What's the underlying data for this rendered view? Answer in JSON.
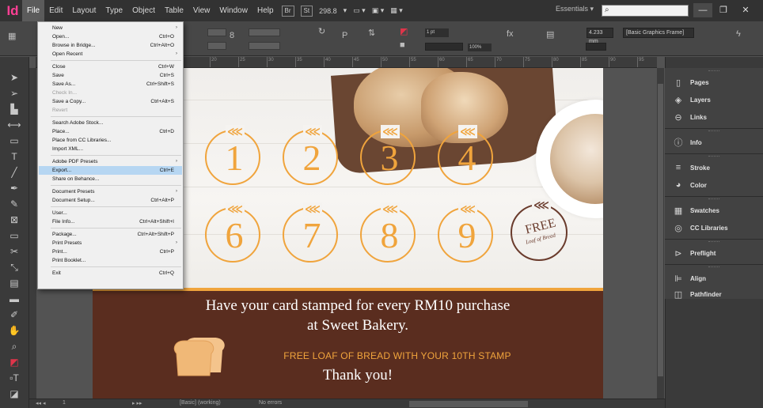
{
  "app": {
    "logo": "Id"
  },
  "menubar": {
    "items": [
      "File",
      "Edit",
      "Layout",
      "Type",
      "Object",
      "Table",
      "View",
      "Window",
      "Help"
    ],
    "br_label": "Br",
    "st_label": "St",
    "zoom": "298.8",
    "workspace": "Essentials",
    "search_placeholder": ""
  },
  "controlbar": {
    "stroke_weight": "1 pt",
    "zoom_percent": "100%",
    "dimension": "4.233 mm",
    "frame_type": "[Basic Graphics Frame]"
  },
  "ruler": {
    "labels": [
      "20",
      "25",
      "30",
      "35",
      "40",
      "45",
      "50",
      "55",
      "60",
      "65",
      "70",
      "75",
      "80",
      "85",
      "90",
      "95",
      "100"
    ]
  },
  "file_menu": [
    {
      "label": "New",
      "shortcut": "",
      "submenu": true
    },
    {
      "label": "Open...",
      "shortcut": "Ctrl+O"
    },
    {
      "label": "Browse in Bridge...",
      "shortcut": "Ctrl+Alt+O"
    },
    {
      "label": "Open Recent",
      "shortcut": "",
      "submenu": true
    },
    {
      "sep": true
    },
    {
      "label": "Close",
      "shortcut": "Ctrl+W"
    },
    {
      "label": "Save",
      "shortcut": "Ctrl+S"
    },
    {
      "label": "Save As...",
      "shortcut": "Ctrl+Shift+S"
    },
    {
      "label": "Check In...",
      "shortcut": "",
      "disabled": true
    },
    {
      "label": "Save a Copy...",
      "shortcut": "Ctrl+Alt+S"
    },
    {
      "label": "Revert",
      "shortcut": "",
      "disabled": true
    },
    {
      "sep": true
    },
    {
      "label": "Search Adobe Stock...",
      "shortcut": ""
    },
    {
      "label": "Place...",
      "shortcut": "Ctrl+D"
    },
    {
      "label": "Place from CC Libraries...",
      "shortcut": ""
    },
    {
      "label": "Import XML...",
      "shortcut": ""
    },
    {
      "sep": true
    },
    {
      "label": "Adobe PDF Presets",
      "shortcut": "",
      "submenu": true
    },
    {
      "label": "Export...",
      "shortcut": "Ctrl+E",
      "highlighted": true
    },
    {
      "label": "Share on Behance...",
      "shortcut": ""
    },
    {
      "sep": true
    },
    {
      "label": "Document Presets",
      "shortcut": "",
      "submenu": true
    },
    {
      "label": "Document Setup...",
      "shortcut": "Ctrl+Alt+P"
    },
    {
      "sep": true
    },
    {
      "label": "User...",
      "shortcut": ""
    },
    {
      "label": "File Info...",
      "shortcut": "Ctrl+Alt+Shift+I"
    },
    {
      "sep": true
    },
    {
      "label": "Package...",
      "shortcut": "Ctrl+Alt+Shift+P"
    },
    {
      "label": "Print Presets",
      "shortcut": "",
      "submenu": true
    },
    {
      "label": "Print...",
      "shortcut": "Ctrl+P"
    },
    {
      "label": "Print Booklet...",
      "shortcut": ""
    },
    {
      "sep": true
    },
    {
      "label": "Exit",
      "shortcut": "Ctrl+Q"
    }
  ],
  "card": {
    "stamps_row1": [
      "1",
      "2",
      "3",
      "4"
    ],
    "stamps_row2": [
      "6",
      "7",
      "8",
      "9"
    ],
    "free_stamp": {
      "title": "FREE",
      "subtitle": "Loaf of Bread"
    },
    "headline_line1": "Have your card stamped for every RM10 purchase",
    "headline_line2": "at Sweet Bakery.",
    "free_line": "FREE LOAF OF BREAD WITH YOUR 10TH STAMP",
    "thanks": "Thank you!",
    "colors": {
      "orange": "#f0a43c",
      "brown": "#5a2d1f"
    }
  },
  "panels": [
    {
      "label": "Pages",
      "icon": "pages-icon"
    },
    {
      "label": "Layers",
      "icon": "layers-icon"
    },
    {
      "label": "Links",
      "icon": "links-icon"
    },
    {
      "label": "Info",
      "icon": "info-icon"
    },
    {
      "label": "Stroke",
      "icon": "stroke-icon"
    },
    {
      "label": "Color",
      "icon": "color-icon"
    },
    {
      "label": "Swatches",
      "icon": "swatches-icon"
    },
    {
      "label": "CC Libraries",
      "icon": "cc-libraries-icon"
    },
    {
      "label": "Preflight",
      "icon": "preflight-icon"
    },
    {
      "label": "Align",
      "icon": "align-icon"
    },
    {
      "label": "Pathfinder",
      "icon": "pathfinder-icon"
    }
  ],
  "statusbar": {
    "page": "1",
    "master": "[Basic] (working)",
    "preflight": "No errors"
  }
}
